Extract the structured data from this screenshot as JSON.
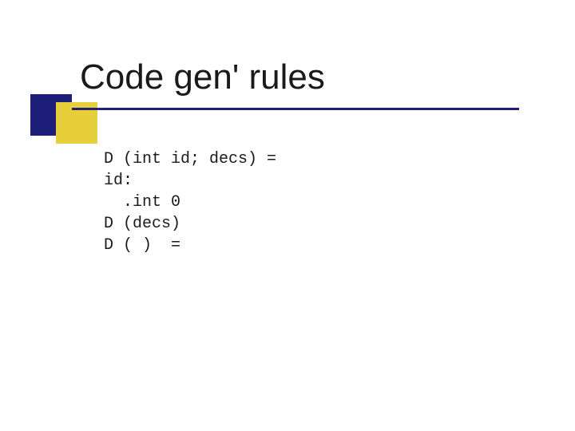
{
  "slide": {
    "title": "Code gen' rules",
    "code_lines": {
      "l1": "D (int id; decs) =",
      "l2": "id:",
      "l3": "  .int 0",
      "l4": "D (decs)",
      "l5": "D ( )  ="
    }
  },
  "colors": {
    "navy": "#1f1f7a",
    "yellow": "#e6cf3a"
  }
}
